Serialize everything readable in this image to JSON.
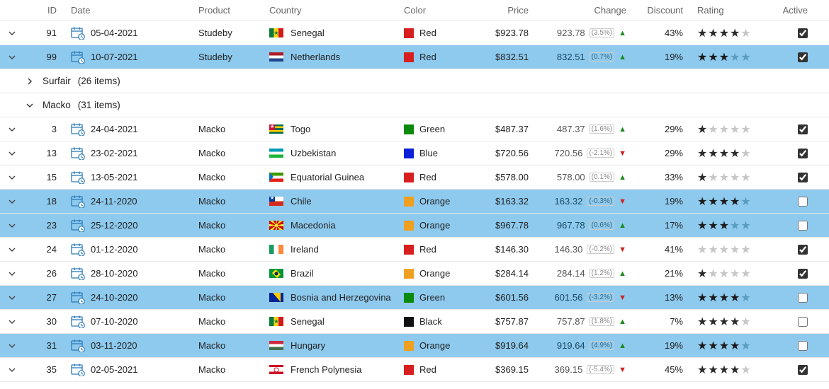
{
  "columns": {
    "id": "ID",
    "date": "Date",
    "product": "Product",
    "country": "Country",
    "color": "Color",
    "price": "Price",
    "change": "Change",
    "discount": "Discount",
    "rating": "Rating",
    "active": "Active"
  },
  "groups": [
    {
      "name": "Surfair",
      "count_label": "(26 items)",
      "expanded": false
    },
    {
      "name": "Macko",
      "count_label": "(31 items)",
      "expanded": true
    }
  ],
  "rows": [
    {
      "pos": "top",
      "selected": false,
      "id": "91",
      "date": "05-04-2021",
      "product": "Studeby",
      "country": "Senegal",
      "flag": "senegal",
      "color": "Red",
      "color_hex": "#d81e1e",
      "price": "$923.78",
      "change": "923.78",
      "pct": "(3.5%)",
      "dir": "up",
      "discount": "43%",
      "rating": 4,
      "active": true
    },
    {
      "pos": "top",
      "selected": true,
      "id": "99",
      "date": "10-07-2021",
      "product": "Studeby",
      "country": "Netherlands",
      "flag": "netherlands",
      "color": "Red",
      "color_hex": "#d81e1e",
      "price": "$832.51",
      "change": "832.51",
      "pct": "(0.7%)",
      "dir": "up",
      "discount": "19%",
      "rating": 3,
      "active": true
    },
    {
      "pos": "macko",
      "selected": false,
      "id": "3",
      "date": "24-04-2021",
      "product": "Macko",
      "country": "Togo",
      "flag": "togo",
      "color": "Green",
      "color_hex": "#0b8a0b",
      "price": "$487.37",
      "change": "487.37",
      "pct": "(1.6%)",
      "dir": "up",
      "discount": "29%",
      "rating": 1,
      "active": true
    },
    {
      "pos": "macko",
      "selected": false,
      "id": "13",
      "date": "23-02-2021",
      "product": "Macko",
      "country": "Uzbekistan",
      "flag": "uzbekistan",
      "color": "Blue",
      "color_hex": "#0a1fd8",
      "price": "$720.56",
      "change": "720.56",
      "pct": "(-2.1%)",
      "dir": "down",
      "discount": "29%",
      "rating": 4,
      "active": true
    },
    {
      "pos": "macko",
      "selected": false,
      "id": "15",
      "date": "13-05-2021",
      "product": "Macko",
      "country": "Equatorial Guinea",
      "flag": "eqguinea",
      "color": "Red",
      "color_hex": "#d81e1e",
      "price": "$578.00",
      "change": "578.00",
      "pct": "(0.1%)",
      "dir": "up",
      "discount": "33%",
      "rating": 1,
      "active": true
    },
    {
      "pos": "macko",
      "selected": true,
      "id": "18",
      "date": "24-11-2020",
      "product": "Macko",
      "country": "Chile",
      "flag": "chile",
      "color": "Orange",
      "color_hex": "#f0a020",
      "price": "$163.32",
      "change": "163.32",
      "pct": "(-0.3%)",
      "dir": "down",
      "discount": "19%",
      "rating": 4,
      "active": false
    },
    {
      "pos": "macko",
      "selected": true,
      "id": "23",
      "date": "25-12-2020",
      "product": "Macko",
      "country": "Macedonia",
      "flag": "macedonia",
      "color": "Orange",
      "color_hex": "#f0a020",
      "price": "$967.78",
      "change": "967.78",
      "pct": "(0.6%)",
      "dir": "up",
      "discount": "17%",
      "rating": 3,
      "active": false
    },
    {
      "pos": "macko",
      "selected": false,
      "id": "24",
      "date": "01-12-2020",
      "product": "Macko",
      "country": "Ireland",
      "flag": "ireland",
      "color": "Red",
      "color_hex": "#d81e1e",
      "price": "$146.30",
      "change": "146.30",
      "pct": "(-0.2%)",
      "dir": "down",
      "discount": "41%",
      "rating": 0,
      "active": true
    },
    {
      "pos": "macko",
      "selected": false,
      "id": "26",
      "date": "28-10-2020",
      "product": "Macko",
      "country": "Brazil",
      "flag": "brazil",
      "color": "Orange",
      "color_hex": "#f0a020",
      "price": "$284.14",
      "change": "284.14",
      "pct": "(1.2%)",
      "dir": "up",
      "discount": "21%",
      "rating": 1,
      "active": true
    },
    {
      "pos": "macko",
      "selected": true,
      "id": "27",
      "date": "24-10-2020",
      "product": "Macko",
      "country": "Bosnia and Herzegovina",
      "flag": "bosnia",
      "color": "Green",
      "color_hex": "#0b8a0b",
      "price": "$601.56",
      "change": "601.56",
      "pct": "(-3.2%)",
      "dir": "down",
      "discount": "13%",
      "rating": 4,
      "active": false
    },
    {
      "pos": "macko",
      "selected": false,
      "id": "30",
      "date": "07-10-2020",
      "product": "Macko",
      "country": "Senegal",
      "flag": "senegal",
      "color": "Black",
      "color_hex": "#111",
      "price": "$757.87",
      "change": "757.87",
      "pct": "(1.8%)",
      "dir": "up",
      "discount": "7%",
      "rating": 4,
      "active": false
    },
    {
      "pos": "macko",
      "selected": true,
      "id": "31",
      "date": "03-11-2020",
      "product": "Macko",
      "country": "Hungary",
      "flag": "hungary",
      "color": "Orange",
      "color_hex": "#f0a020",
      "price": "$919.64",
      "change": "919.64",
      "pct": "(4.9%)",
      "dir": "up",
      "discount": "19%",
      "rating": 4,
      "active": false
    },
    {
      "pos": "macko",
      "selected": false,
      "id": "35",
      "date": "02-05-2021",
      "product": "Macko",
      "country": "French Polynesia",
      "flag": "polynesia",
      "color": "Red",
      "color_hex": "#d81e1e",
      "price": "$369.15",
      "change": "369.15",
      "pct": "(-5.4%)",
      "dir": "down",
      "discount": "45%",
      "rating": 4,
      "active": true
    }
  ]
}
